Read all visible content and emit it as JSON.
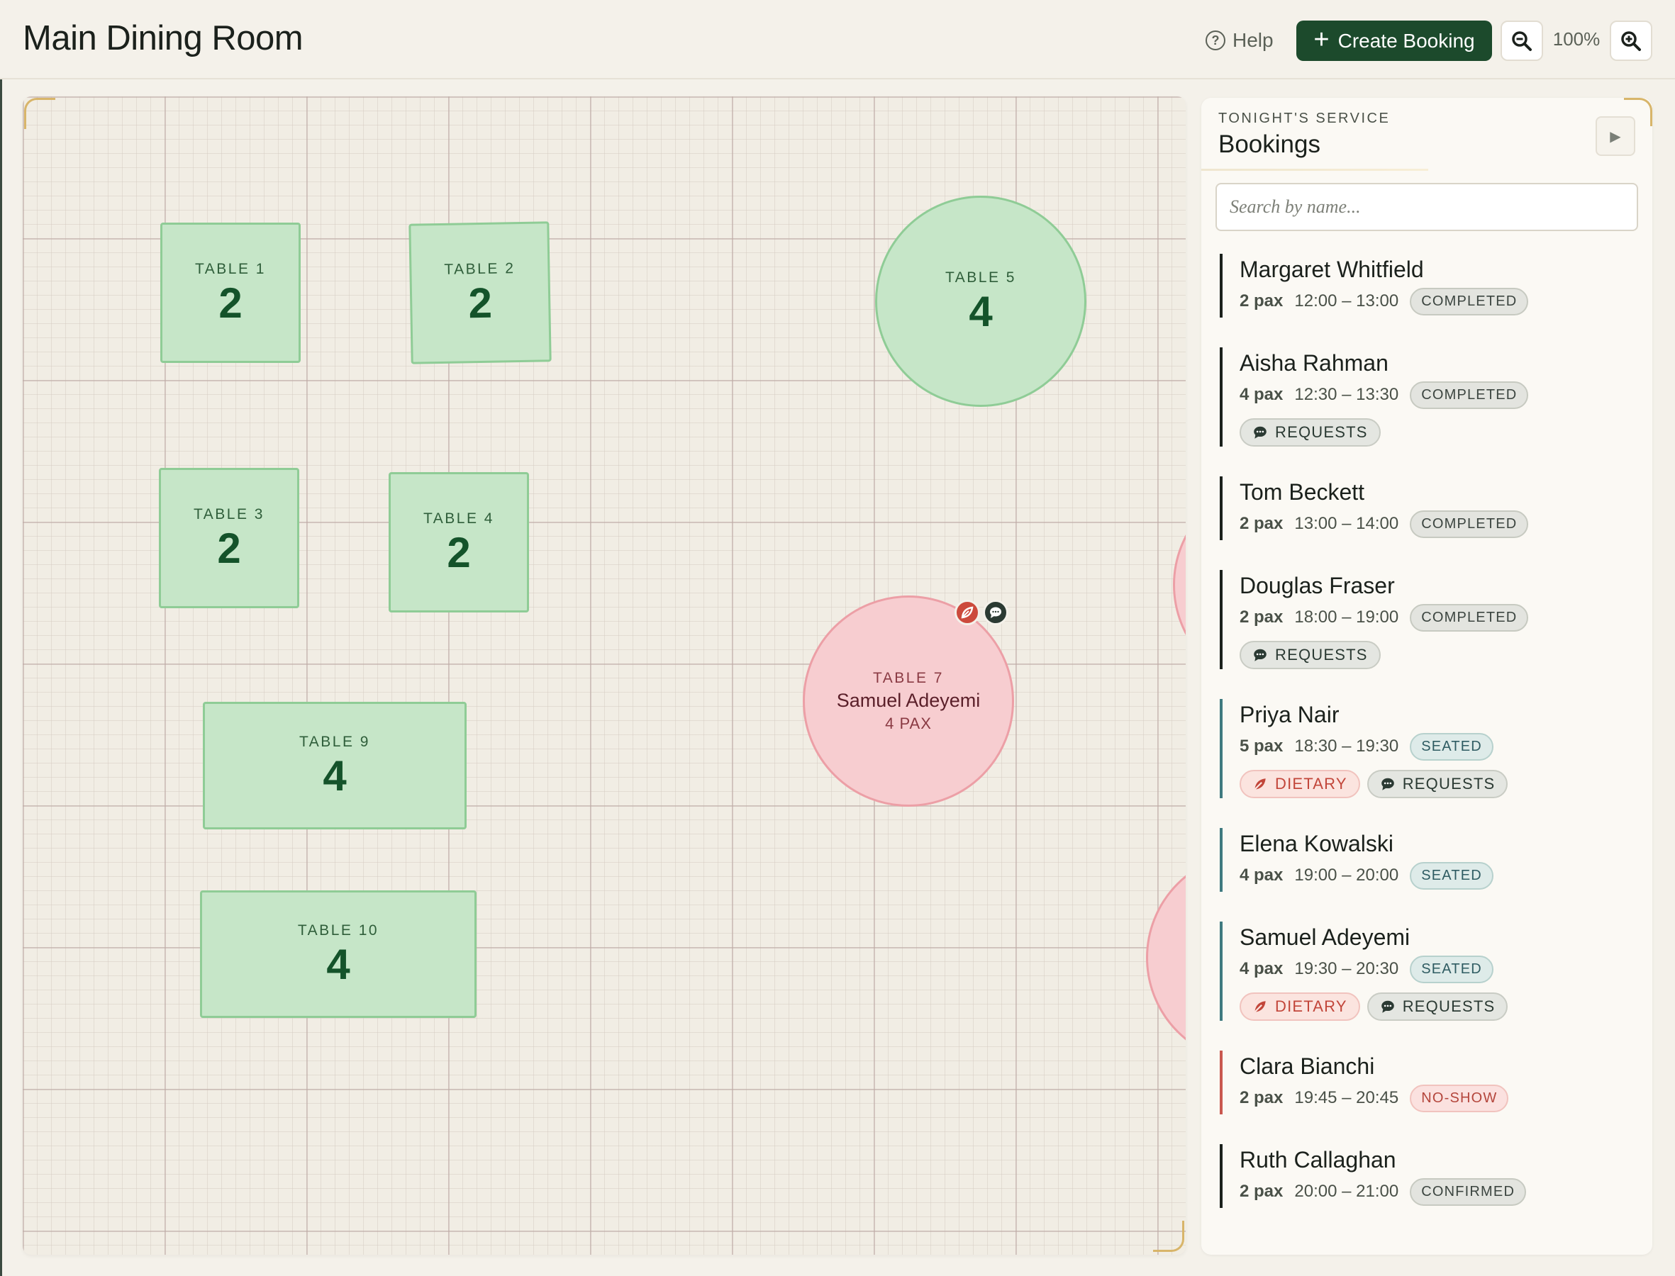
{
  "header": {
    "title": "Main Dining Room",
    "help_label": "Help",
    "create_label": "Create Booking",
    "zoom_level": "100%"
  },
  "floor": {
    "tables": [
      {
        "label": "TABLE 1",
        "capacity": "2",
        "shape": "square",
        "status": "free"
      },
      {
        "label": "TABLE 2",
        "capacity": "2",
        "shape": "square",
        "status": "free"
      },
      {
        "label": "TABLE 3",
        "capacity": "2",
        "shape": "square",
        "status": "free"
      },
      {
        "label": "TABLE 4",
        "capacity": "2",
        "shape": "square",
        "status": "free"
      },
      {
        "label": "TABLE 5",
        "capacity": "4",
        "shape": "round",
        "status": "free"
      },
      {
        "label": "TABLE 7",
        "guest": "Samuel Adeyemi",
        "pax": "4 PAX",
        "shape": "round",
        "status": "occupied",
        "icons": [
          "dietary-icon",
          "requests-icon"
        ]
      },
      {
        "label": "TABLE 9",
        "capacity": "4",
        "shape": "rect",
        "status": "free"
      },
      {
        "label": "TABLE 10",
        "capacity": "4",
        "shape": "rect",
        "status": "free"
      }
    ]
  },
  "sidebar": {
    "kicker": "TONIGHT'S SERVICE",
    "title": "Bookings",
    "search_placeholder": "Search by name...",
    "bookings": [
      {
        "name": "Margaret Whitfield",
        "pax": "2 pax",
        "time": "12:00 – 13:00",
        "status": "COMPLETED",
        "tags": []
      },
      {
        "name": "Aisha Rahman",
        "pax": "4 pax",
        "time": "12:30 – 13:30",
        "status": "COMPLETED",
        "tags": [
          "REQUESTS"
        ]
      },
      {
        "name": "Tom Beckett",
        "pax": "2 pax",
        "time": "13:00 – 14:00",
        "status": "COMPLETED",
        "tags": []
      },
      {
        "name": "Douglas Fraser",
        "pax": "2 pax",
        "time": "18:00 – 19:00",
        "status": "COMPLETED",
        "tags": [
          "REQUESTS"
        ]
      },
      {
        "name": "Priya Nair",
        "pax": "5 pax",
        "time": "18:30 – 19:30",
        "status": "SEATED",
        "tags": [
          "DIETARY",
          "REQUESTS"
        ]
      },
      {
        "name": "Elena Kowalski",
        "pax": "4 pax",
        "time": "19:00 – 20:00",
        "status": "SEATED",
        "tags": []
      },
      {
        "name": "Samuel Adeyemi",
        "pax": "4 pax",
        "time": "19:30 – 20:30",
        "status": "SEATED",
        "tags": [
          "DIETARY",
          "REQUESTS"
        ]
      },
      {
        "name": "Clara Bianchi",
        "pax": "2 pax",
        "time": "19:45 – 20:45",
        "status": "NO-SHOW",
        "tags": []
      },
      {
        "name": "Ruth Callaghan",
        "pax": "2 pax",
        "time": "20:00 – 21:00",
        "status": "CONFIRMED",
        "tags": []
      }
    ]
  },
  "colors": {
    "accent": "#1c4a2c",
    "table_free": "#c6e6c8",
    "table_occupied": "#f7cdd0",
    "dietary": "#c2463a",
    "seated": "#3f7a80"
  }
}
